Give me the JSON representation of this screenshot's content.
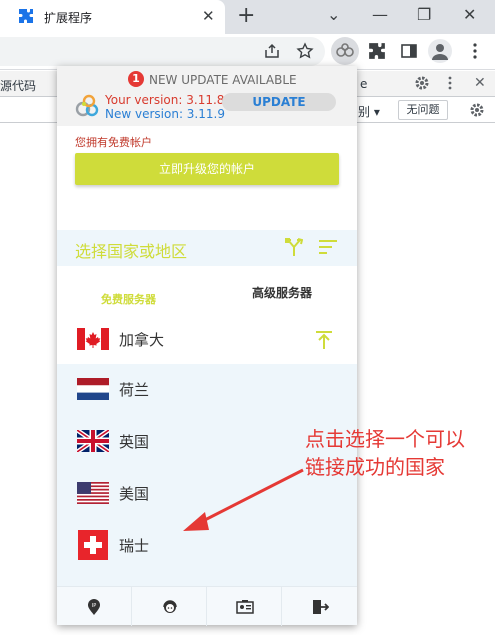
{
  "browser": {
    "tab_title": "扩展程序",
    "tab_icon": "puzzle-icon",
    "close_glyph": "✕",
    "new_tab_glyph": "+",
    "window_controls": {
      "dropdown": "⌄",
      "minimize": "—",
      "restore": "❐",
      "close": "✕"
    }
  },
  "devtools": {
    "source_tab": "源代码",
    "partial_tab": "e",
    "level_select": "别 ▾",
    "issues_button": "无问题"
  },
  "popup": {
    "badge_count": "1",
    "new_update_text": "NEW UPDATE AVAILABLE",
    "your_version": "Your version: 3.11.8",
    "new_version": "New version: 3.11.9",
    "update_button": "UPDATE",
    "free_account_text": "您拥有免费帐户",
    "upgrade_button": "立即升级您的帐户",
    "select_placeholder": "选择国家或地区",
    "tabs": {
      "free": "免费服务器",
      "premium": "高级服务器"
    },
    "countries": [
      {
        "name": "加拿大",
        "flag": "canada-flag-icon"
      },
      {
        "name": "荷兰",
        "flag": "netherlands-flag-icon"
      },
      {
        "name": "英国",
        "flag": "uk-flag-icon"
      },
      {
        "name": "美国",
        "flag": "usa-flag-icon"
      },
      {
        "name": "瑞士",
        "flag": "switzerland-flag-icon"
      }
    ],
    "footer_icons": [
      "ip-location-icon",
      "support-agent-icon",
      "id-card-icon",
      "logout-icon"
    ]
  },
  "annotation": {
    "line1": "点击选择一个可以",
    "line2": "链接成功的国家",
    "color": "#e53935"
  },
  "colors": {
    "accent_green": "#cfdc3a",
    "version_red": "#d83b2e",
    "version_blue": "#2a7fd4",
    "list_bg": "#eef6fb"
  }
}
